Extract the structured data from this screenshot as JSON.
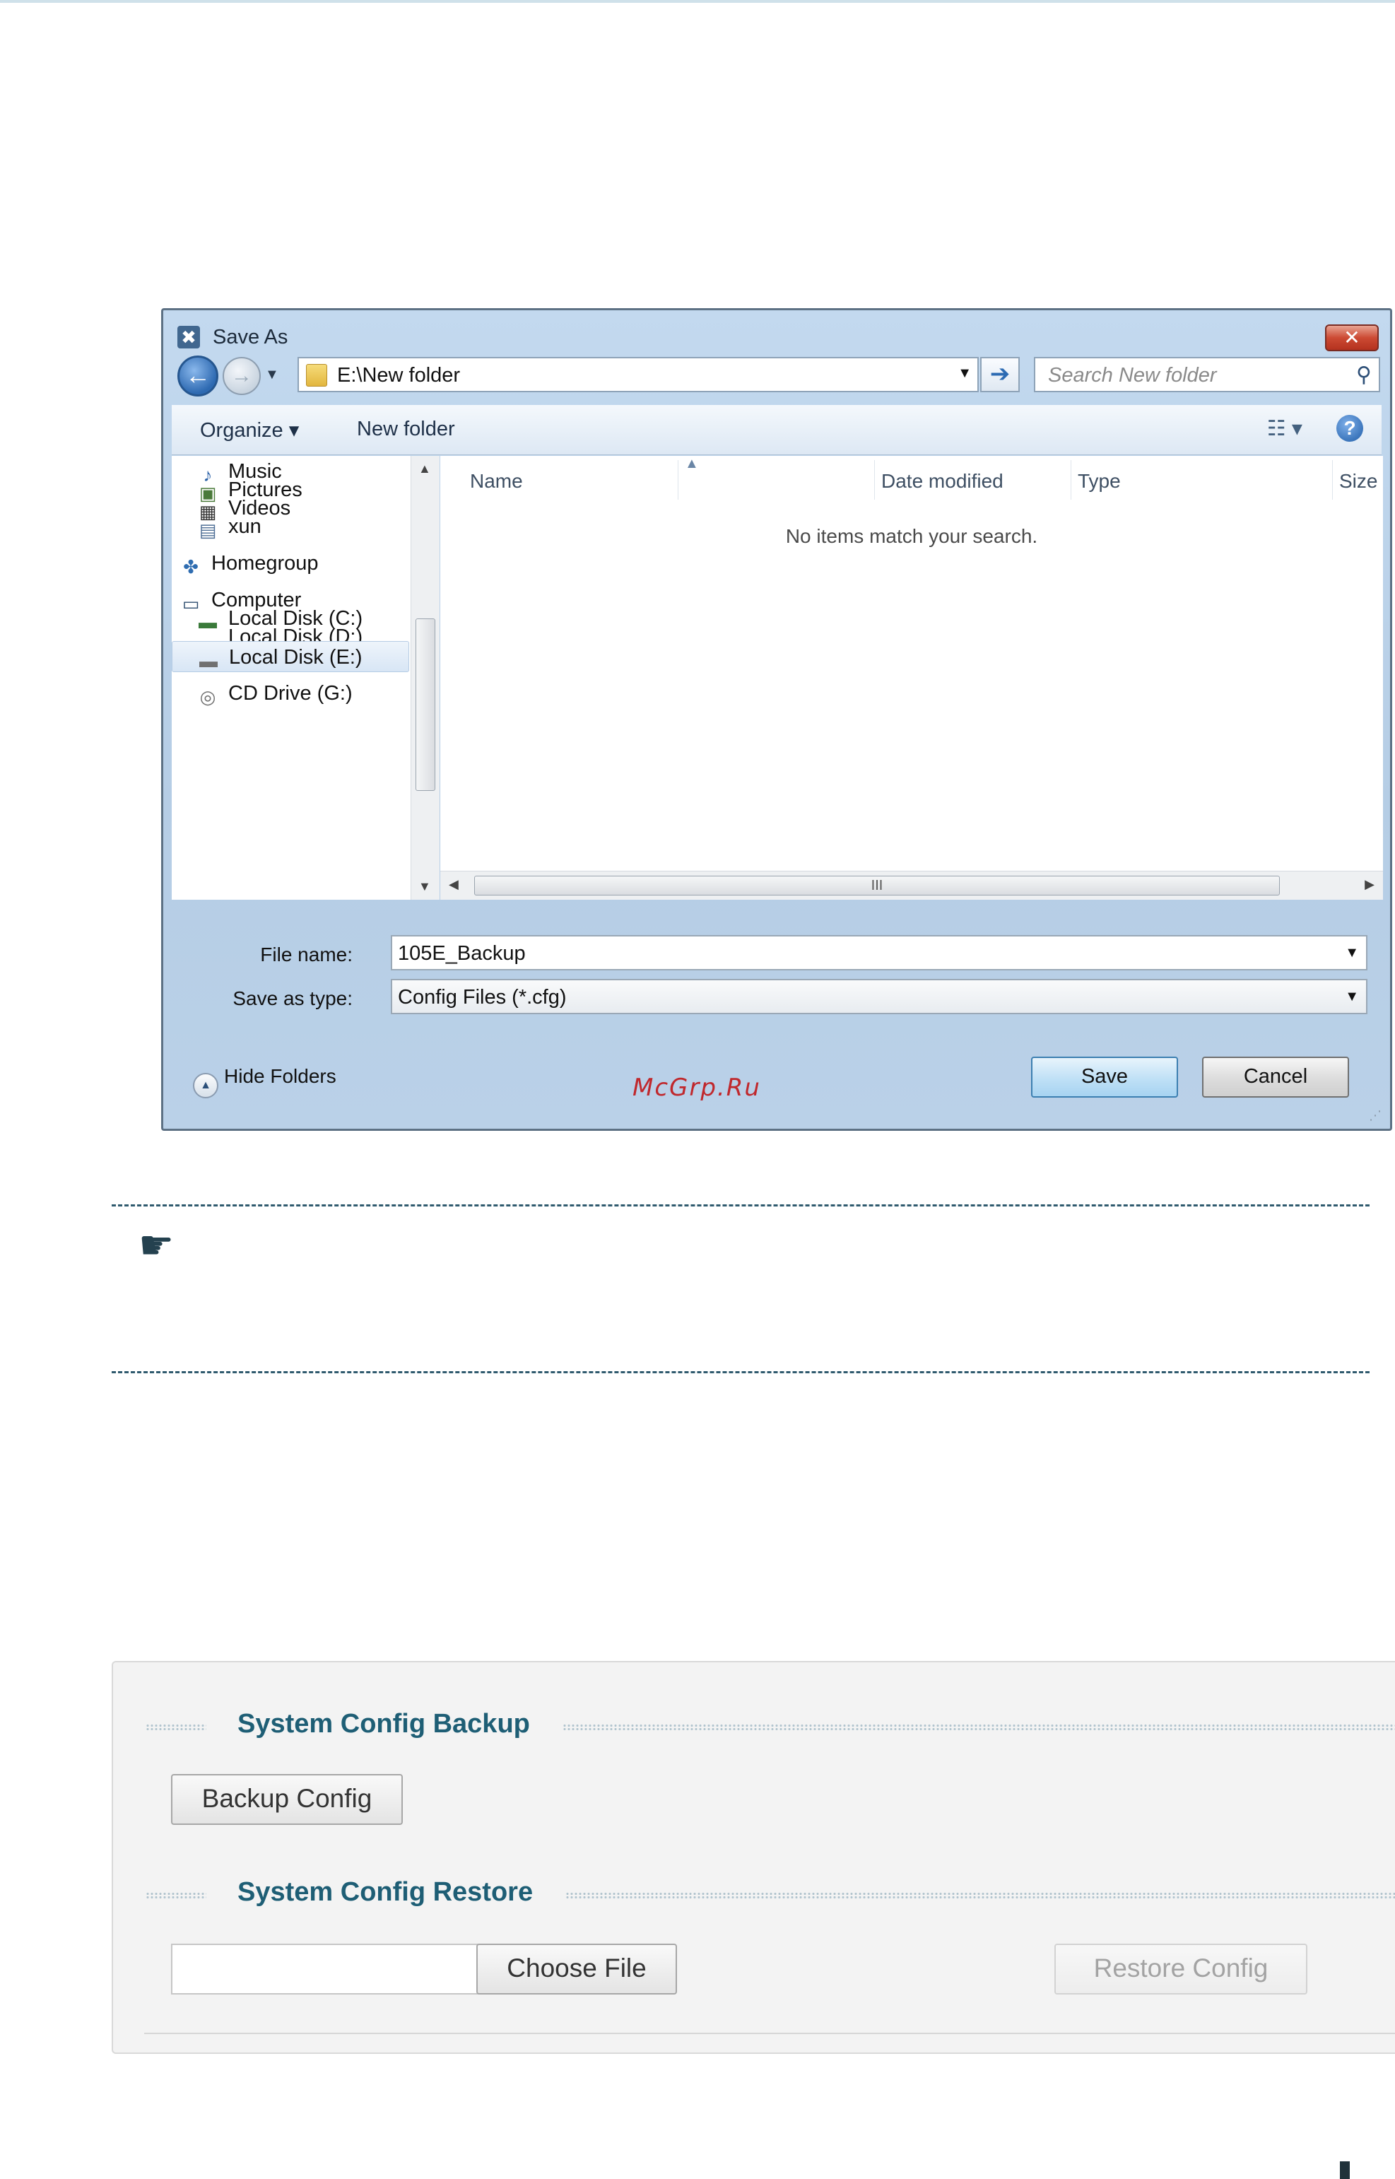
{
  "dialog": {
    "title": "Save As",
    "close_glyph": "✕",
    "address": "E:\\New folder",
    "search_placeholder": "Search New folder",
    "toolbar": {
      "organize": "Organize ▾",
      "new_folder": "New folder",
      "help_glyph": "?"
    },
    "nav_items": [
      {
        "label": "Music",
        "icon": "music-icon"
      },
      {
        "label": "Pictures",
        "icon": "pictures-icon"
      },
      {
        "label": "Videos",
        "icon": "videos-icon"
      },
      {
        "label": "xun",
        "icon": "document-icon"
      },
      {
        "label": "Homegroup",
        "icon": "homegroup-icon"
      },
      {
        "label": "Computer",
        "icon": "computer-icon"
      },
      {
        "label": "Local Disk (C:)",
        "icon": "windows-drive-icon"
      },
      {
        "label": "Local Disk (D:)",
        "icon": "drive-icon"
      },
      {
        "label": "Local Disk (E:)",
        "icon": "drive-icon",
        "selected": true
      },
      {
        "label": "CD Drive (G:)",
        "icon": "cd-drive-icon"
      }
    ],
    "columns": [
      "Name",
      "Date modified",
      "Type",
      "Size"
    ],
    "empty_message": "No items match your search.",
    "hscroll_grip": "III",
    "file_name_label": "File name:",
    "file_name_value": "105E_Backup",
    "save_type_label": "Save as type:",
    "save_type_value": "Config Files (*.cfg)",
    "hide_folders": "Hide Folders",
    "save_button": "Save",
    "cancel_button": "Cancel"
  },
  "watermark": "McGrp.Ru",
  "note": {
    "icon": "pointing-hand-icon"
  },
  "config_panel": {
    "backup_title": "System Config Backup",
    "backup_button": "Backup Config",
    "restore_title": "System Config Restore",
    "choose_file_button": "Choose File",
    "file_value": "",
    "restore_button": "Restore Config"
  },
  "colors": {
    "section_title": "#1e5e75",
    "note_border": "#2f5a6e",
    "watermark": "#c0282d",
    "dialog_frame": "#b5cde5"
  }
}
